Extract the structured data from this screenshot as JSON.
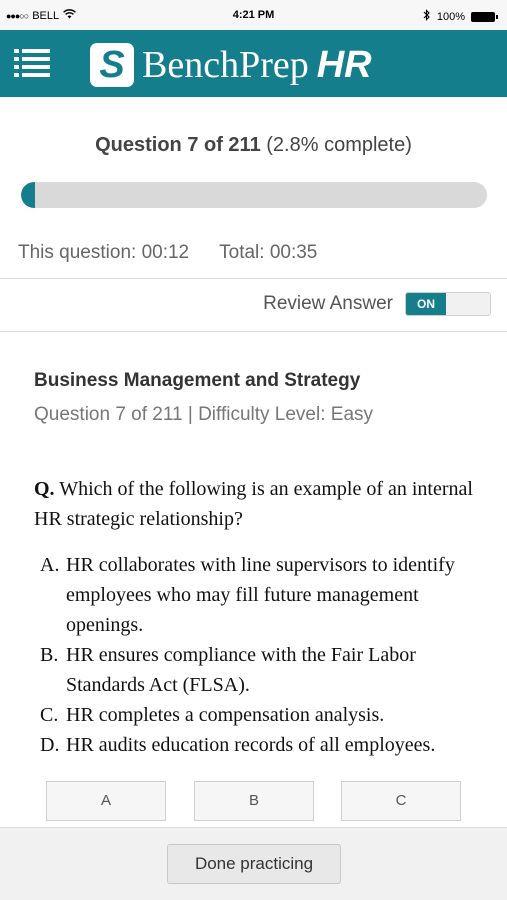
{
  "status_bar": {
    "carrier": "BELL",
    "signal_icon": "signal-dots-icon",
    "wifi_icon": "wifi-icon",
    "time": "4:21 PM",
    "bluetooth_icon": "bluetooth-icon",
    "battery": "100%"
  },
  "header": {
    "menu_icon": "list-menu-icon",
    "logo_mark": "S",
    "brand": "BenchPrep",
    "brand_suffix": "HR",
    "color": "#157e8c"
  },
  "progress": {
    "label": "Question 7 of 211",
    "percent_text": "(2.8% complete)",
    "fraction": 0.028
  },
  "timers": {
    "this_question": "This question: 00:12",
    "total": "Total: 00:35"
  },
  "review": {
    "label": "Review Answer",
    "toggle_state": "ON"
  },
  "question": {
    "category": "Business Management and Strategy",
    "meta": "Question 7 of 211 | Difficulty Level: Easy",
    "prefix": "Q.",
    "text": "Which of the following is an example of an internal HR strategic relationship?",
    "options": [
      {
        "letter": "A.",
        "text": "HR collaborates with line supervisors to identify employees who may fill future management openings."
      },
      {
        "letter": "B.",
        "text": "HR ensures compliance with the Fair Labor Standards Act (FLSA)."
      },
      {
        "letter": "C.",
        "text": "HR completes a compensation analysis."
      },
      {
        "letter": "D.",
        "text": "HR audits education records of all employees."
      }
    ]
  },
  "answer_buttons": [
    "A",
    "B",
    "C"
  ],
  "footer": {
    "done_label": "Done practicing"
  }
}
